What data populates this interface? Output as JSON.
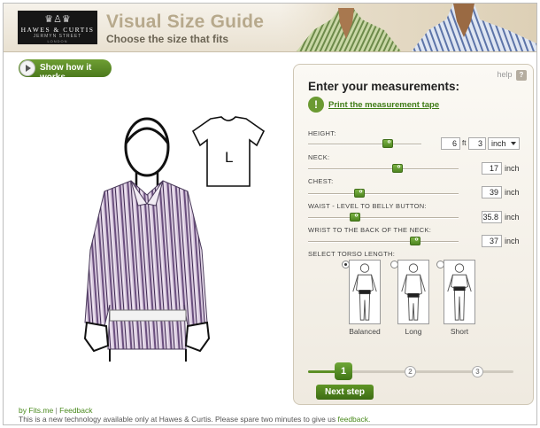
{
  "header": {
    "logo": {
      "brand": "HAWES & CURTIS",
      "street": "JERMYN STREET",
      "city": "LONDON"
    },
    "title": "Visual Size Guide",
    "subtitle": "Choose the size that fits"
  },
  "left": {
    "show_button": "Show how it works",
    "tshirt_size": "L"
  },
  "panel": {
    "help_label": "help",
    "help_icon": "?",
    "title": "Enter your measurements:",
    "print_icon": "!",
    "print_link": "Print the measurement tape",
    "measurements": {
      "height": {
        "label": "HEIGHT:",
        "feet": "6",
        "feet_unit": "ft",
        "inches": "3",
        "unit_select": "inch",
        "slider_level": 0.72
      },
      "neck": {
        "label": "NECK:",
        "value": "17",
        "unit": "inch",
        "slider_level": 0.6
      },
      "chest": {
        "label": "CHEST:",
        "value": "39",
        "unit": "inch",
        "slider_level": 0.33
      },
      "waist": {
        "label": "WAIST - LEVEL TO BELLY BUTTON:",
        "value": "35.8",
        "unit": "inch",
        "slider_level": 0.3
      },
      "back_neck": {
        "label": "WRIST TO THE BACK OF THE NECK:",
        "value": "37",
        "unit": "inch",
        "slider_level": 0.73
      }
    },
    "torso": {
      "label": "SELECT TORSO LENGTH:",
      "options": [
        {
          "label": "Balanced",
          "selected": true
        },
        {
          "label": "Long",
          "selected": false
        },
        {
          "label": "Short",
          "selected": false
        }
      ]
    },
    "steps": [
      "1",
      "2",
      "3"
    ],
    "next_button": "Next step"
  },
  "footer": {
    "by": "by Fits.me",
    "sep": "|",
    "feedback": "Feedback",
    "note": "This is a new technology available only at Hawes & Curtis. Please spare two minutes to give us",
    "note_link": "feedback."
  },
  "colors": {
    "accent_green": "#4f8420",
    "title_tan": "#b7a98c"
  }
}
